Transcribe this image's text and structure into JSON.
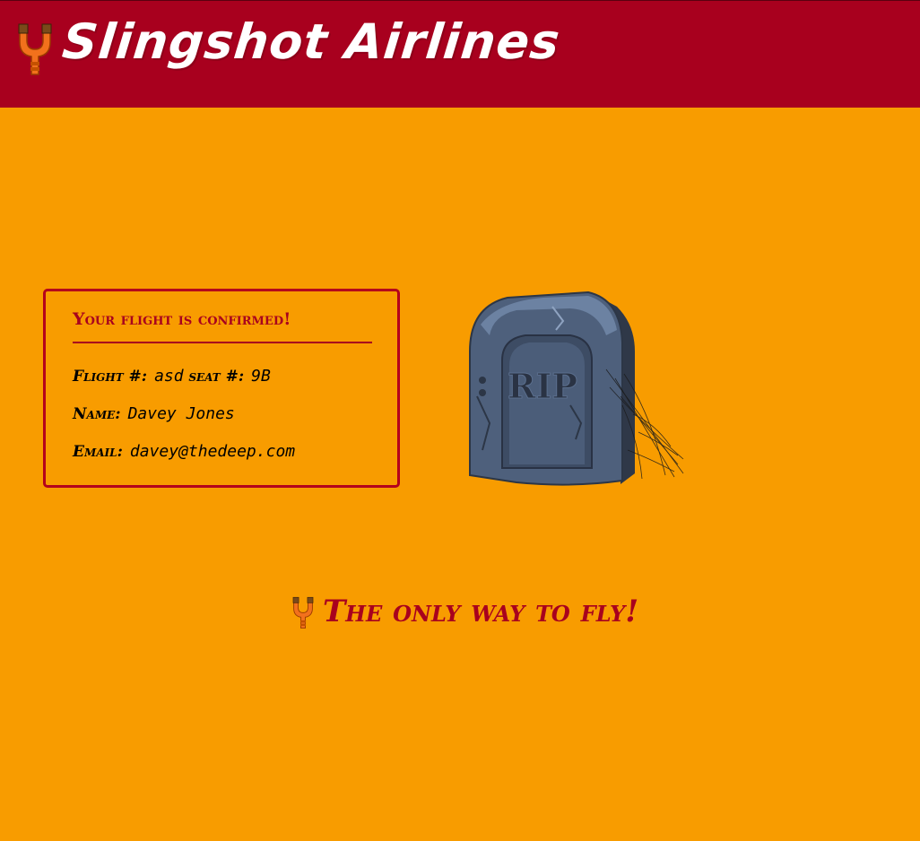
{
  "header": {
    "title": "Slingshot Airlines",
    "logo_icon": "slingshot-icon"
  },
  "confirmation": {
    "heading": "Your flight is confirmed!",
    "flight_label": "Flight #:",
    "flight_value": "asd",
    "seat_label": "seat #:",
    "seat_value": "9B",
    "name_label": "Name:",
    "name_value": "Davey Jones",
    "email_label": "Email:",
    "email_value": "davey@thedeep.com"
  },
  "illustration": {
    "icon": "tombstone-icon",
    "engraving": "RIP"
  },
  "footer": {
    "tagline": "The only way to fly!",
    "tagline_icon": "slingshot-icon"
  },
  "colors": {
    "background": "#f89c00",
    "header": "#a8001e",
    "accent": "#b4001c"
  }
}
